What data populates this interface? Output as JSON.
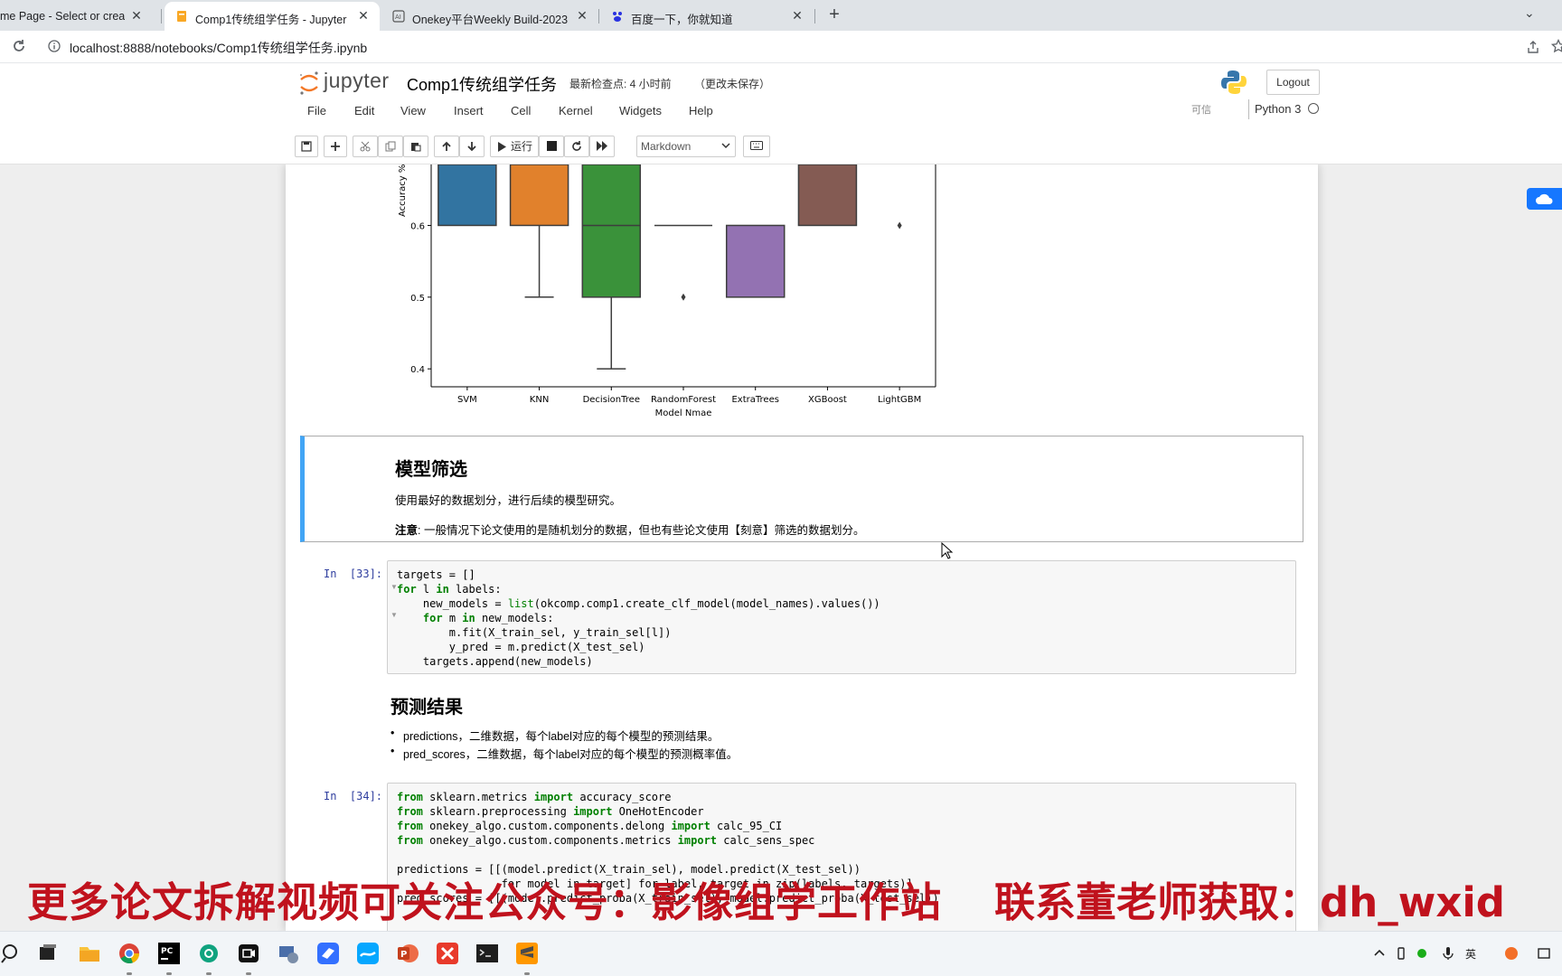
{
  "browser": {
    "tabs": [
      {
        "title": "me Page - Select or create",
        "icon": "jupyter-home-icon",
        "active": false
      },
      {
        "title": "Comp1传统组学任务 - Jupyter",
        "icon": "notebook-icon",
        "active": true
      },
      {
        "title": "Onekey平台Weekly Build-2023",
        "icon": "ai-icon",
        "active": false
      },
      {
        "title": "百度一下，你就知道",
        "icon": "baidu-icon",
        "active": false
      }
    ],
    "new_tab": "+",
    "tab_menu": "⌄",
    "url": "localhost:8888/notebooks/Comp1传统组学任务.ipynb"
  },
  "jupyter": {
    "logo_text": "jupyter",
    "notebook_name": "Comp1传统组学任务",
    "checkpoint": "最新检查点: 4 小时前",
    "unsaved": "（更改未保存）",
    "logout": "Logout",
    "menu": [
      "File",
      "Edit",
      "View",
      "Insert",
      "Cell",
      "Kernel",
      "Widgets",
      "Help"
    ],
    "trusted": "可信",
    "kernel": "Python 3",
    "toolbar": {
      "run_label": "运行",
      "cell_type": "Markdown"
    }
  },
  "chart_data": {
    "type": "box",
    "xlabel": "Model Nmae",
    "ylabel": "Accuracy %",
    "categories": [
      "SVM",
      "KNN",
      "DecisionTree",
      "RandomForest",
      "ExtraTrees",
      "XGBoost",
      "LightGBM"
    ],
    "y_ticks": [
      0.4,
      0.5,
      0.6
    ],
    "visible_ylim": [
      0.375,
      0.685
    ],
    "colors": [
      "#3274a1",
      "#e1812c",
      "#3a923a",
      "#c03d3e",
      "#9372b2",
      "#845b53",
      "#d684bd"
    ],
    "boxes": [
      {
        "name": "SVM",
        "q1": 0.6,
        "q3": 0.7,
        "median": null,
        "whisker_low": 0.6,
        "outliers": []
      },
      {
        "name": "KNN",
        "q1": 0.6,
        "q3": 0.7,
        "median": null,
        "whisker_low": 0.5,
        "outliers": []
      },
      {
        "name": "DecisionTree",
        "q1": 0.5,
        "q3": 0.7,
        "median": 0.6,
        "whisker_low": 0.4,
        "outliers": []
      },
      {
        "name": "RandomForest",
        "q1": 0.6,
        "q3": 0.6,
        "median": 0.6,
        "whisker_low": 0.6,
        "outliers": [
          0.5
        ]
      },
      {
        "name": "ExtraTrees",
        "q1": 0.5,
        "q3": 0.6,
        "median": null,
        "whisker_low": 0.5,
        "outliers": []
      },
      {
        "name": "XGBoost",
        "q1": 0.6,
        "q3": 0.7,
        "median": null,
        "whisker_low": 0.6,
        "outliers": []
      },
      {
        "name": "LightGBM",
        "q1": null,
        "q3": null,
        "median": null,
        "whisker_low": null,
        "outliers": [
          0.6
        ]
      }
    ]
  },
  "cells": {
    "model_select": {
      "heading": "模型筛选",
      "para1": "使用最好的数据划分，进行后续的模型研究。",
      "note_bold": "注意",
      "note_rest": ": 一般情况下论文使用的是随机划分的数据，但也有些论文使用【刻意】筛选的数据划分。"
    },
    "code33": {
      "prompt": "In  [33]:",
      "lines": [
        "targets = []",
        "for l in labels:",
        "    new_models = list(okcomp.comp1.create_clf_model(model_names).values())",
        "    for m in new_models:",
        "        m.fit(X_train_sel, y_train_sel[l])",
        "        y_pred = m.predict(X_test_sel)",
        "    targets.append(new_models)"
      ]
    },
    "predict": {
      "heading": "预测结果",
      "bullets": [
        "predictions，二维数据，每个label对应的每个模型的预测结果。",
        "pred_scores，二维数据，每个label对应的每个模型的预测概率值。"
      ]
    },
    "code34": {
      "prompt": "In  [34]:",
      "lines": [
        "from sklearn.metrics import accuracy_score",
        "from sklearn.preprocessing import OneHotEncoder",
        "from onekey_algo.custom.components.delong import calc_95_CI",
        "from onekey_algo.custom.components.metrics import calc_sens_spec",
        "",
        "predictions = [[(model.predict(X_train_sel), model.predict(X_test_sel))",
        "                for model in target] for label, target in zip(labels, targets)]",
        "pred_scores = [[(model.predict_proba(X_train_sel), model.predict_proba(X_test_sel))"
      ]
    }
  },
  "watermark": {
    "left": "更多论文拆解视频可关注公众号：影像组学工作站",
    "right": "联系董老师获取：dh_wxid"
  },
  "taskbar": {
    "apps": [
      "search-icon",
      "file-explorer-icon",
      "folder-icon",
      "chrome-icon",
      "pycharm-icon",
      "chatgpt-icon",
      "video-icon",
      "settings-icon",
      "feishu-icon",
      "baidu-netdisk-icon",
      "powerpoint-icon",
      "xmind-icon",
      "terminal-icon",
      "sublime-icon"
    ]
  }
}
